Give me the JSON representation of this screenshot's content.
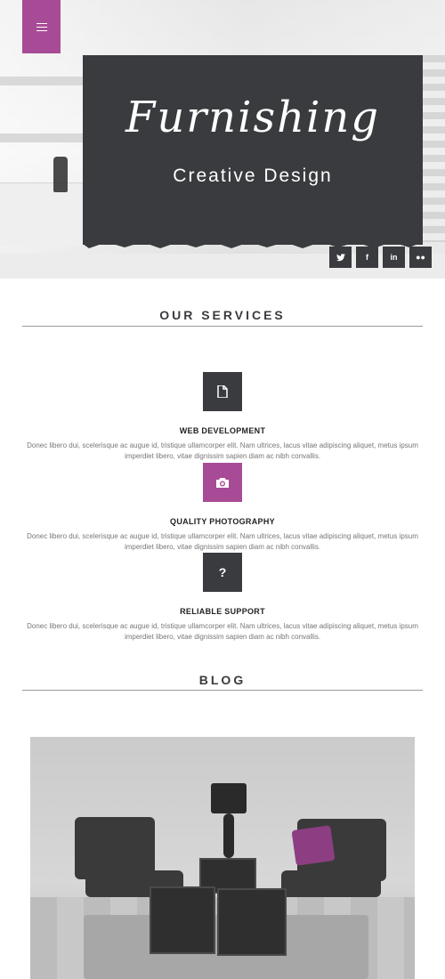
{
  "hero": {
    "title": "Furnishing",
    "subtitle": "Creative Design",
    "social": [
      {
        "icon": "twitter-icon",
        "glyph": "🐦"
      },
      {
        "icon": "facebook-icon",
        "glyph": "f"
      },
      {
        "icon": "linkedin-icon",
        "glyph": "in"
      },
      {
        "icon": "flickr-icon",
        "glyph": "●●"
      }
    ]
  },
  "services": {
    "heading": "OUR SERVICES",
    "items": [
      {
        "title": "WEB DEVELOPMENT",
        "desc": "Donec libero dui, scelerisque ac augue id, tristique ullamcorper elit. Nam ultrices, lacus vitae adipiscing aliquet, metus ipsum imperdiet libero, vitae dignissim sapien diam ac nibh convallis.",
        "icon": "document-icon",
        "color": "#3a3b3f"
      },
      {
        "title": "QUALITY PHOTOGRAPHY",
        "desc": "Donec libero dui, scelerisque ac augue id, tristique ullamcorper elit. Nam ultrices, lacus vitae adipiscing aliquet, metus ipsum imperdiet libero, vitae dignissim sapien diam ac nibh convallis.",
        "icon": "camera-icon",
        "color": "#a84b96"
      },
      {
        "title": "RELIABLE SUPPORT",
        "desc": "Donec libero dui, scelerisque ac augue id, tristique ullamcorper elit. Nam ultrices, lacus vitae adipiscing aliquet, metus ipsum imperdiet libero, vitae dignissim sapien diam ac nibh convallis.",
        "icon": "question-icon",
        "glyph": "?",
        "color": "#3a3b3f"
      }
    ]
  },
  "blog": {
    "heading": "BLOG"
  },
  "colors": {
    "accent": "#a84b96",
    "dark": "#3a3b3f"
  }
}
